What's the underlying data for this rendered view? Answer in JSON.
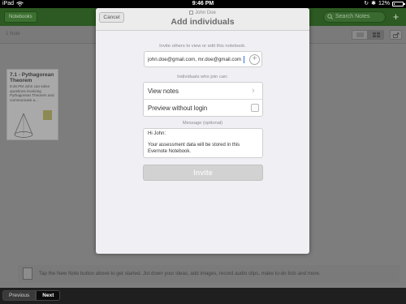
{
  "status_bar": {
    "carrier": "iPad",
    "time": "9:46 PM",
    "battery_text": "12%",
    "battery_level": 0.12
  },
  "header": {
    "notebooks_button": "Notebooks",
    "search_placeholder": "Search Notes",
    "add_button": "+"
  },
  "subbar": {
    "note_count": "1 Note"
  },
  "note_card": {
    "title": "7.1 - Pythagorean Theorem",
    "body": "9:46 PM John can solve questions involving Pythagorean Theorem and communicate a..."
  },
  "modal": {
    "cancel_label": "Cancel",
    "notebook_owner": "John Doe",
    "title": "Add individuals",
    "invite_prompt": "Invite others to view or edit this notebook.",
    "email_value": "john.doe@gmail.com, mr.doe@gmail.com",
    "join_prompt": "Individuals who join can:",
    "options": [
      {
        "label": "View notes"
      },
      {
        "label": "Preview without login"
      }
    ],
    "message_label": "Message (optional)",
    "message_greeting": "Hi John:",
    "message_body": "Your assessment data will be stored in this Evernote Notebook.",
    "invite_label": "Invite"
  },
  "tip": {
    "text": "Tap the New Note button above to get started. Jot down your ideas, add images, record audio clips, make to-do lists and more."
  },
  "bottom_nav": {
    "previous_label": "Previous",
    "next_label": "Next"
  }
}
